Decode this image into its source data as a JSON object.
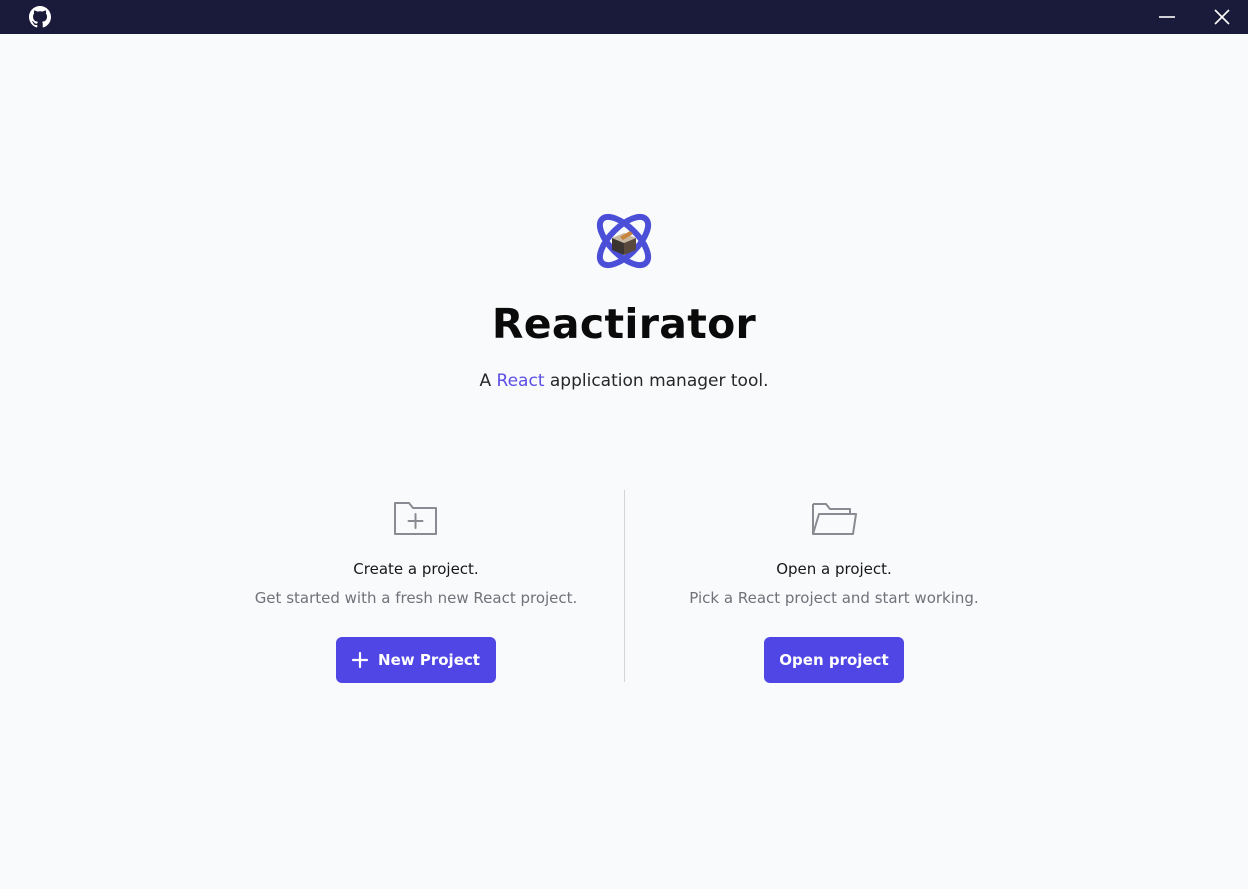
{
  "window": {
    "icons": {
      "github": "github-icon",
      "minimize": "minimize-icon",
      "close": "close-icon"
    }
  },
  "hero": {
    "title": "Reactirator",
    "tagline_prefix": "A ",
    "tagline_accent": "React",
    "tagline_suffix": " application manager tool.",
    "logo_icon": "atom-box-logo"
  },
  "create": {
    "icon": "folder-plus-icon",
    "heading": "Create a project.",
    "description": "Get started with a fresh new React project.",
    "button_label": "New Project",
    "button_icon": "plus-icon"
  },
  "open": {
    "icon": "folder-open-icon",
    "heading": "Open a project.",
    "description": "Pick a React project and start working.",
    "button_label": "Open project"
  },
  "colors": {
    "titlebar": "#1a1b3a",
    "background": "#f9fafb",
    "accent": "#4f46e5",
    "accent_text": "#5b4ee6"
  }
}
